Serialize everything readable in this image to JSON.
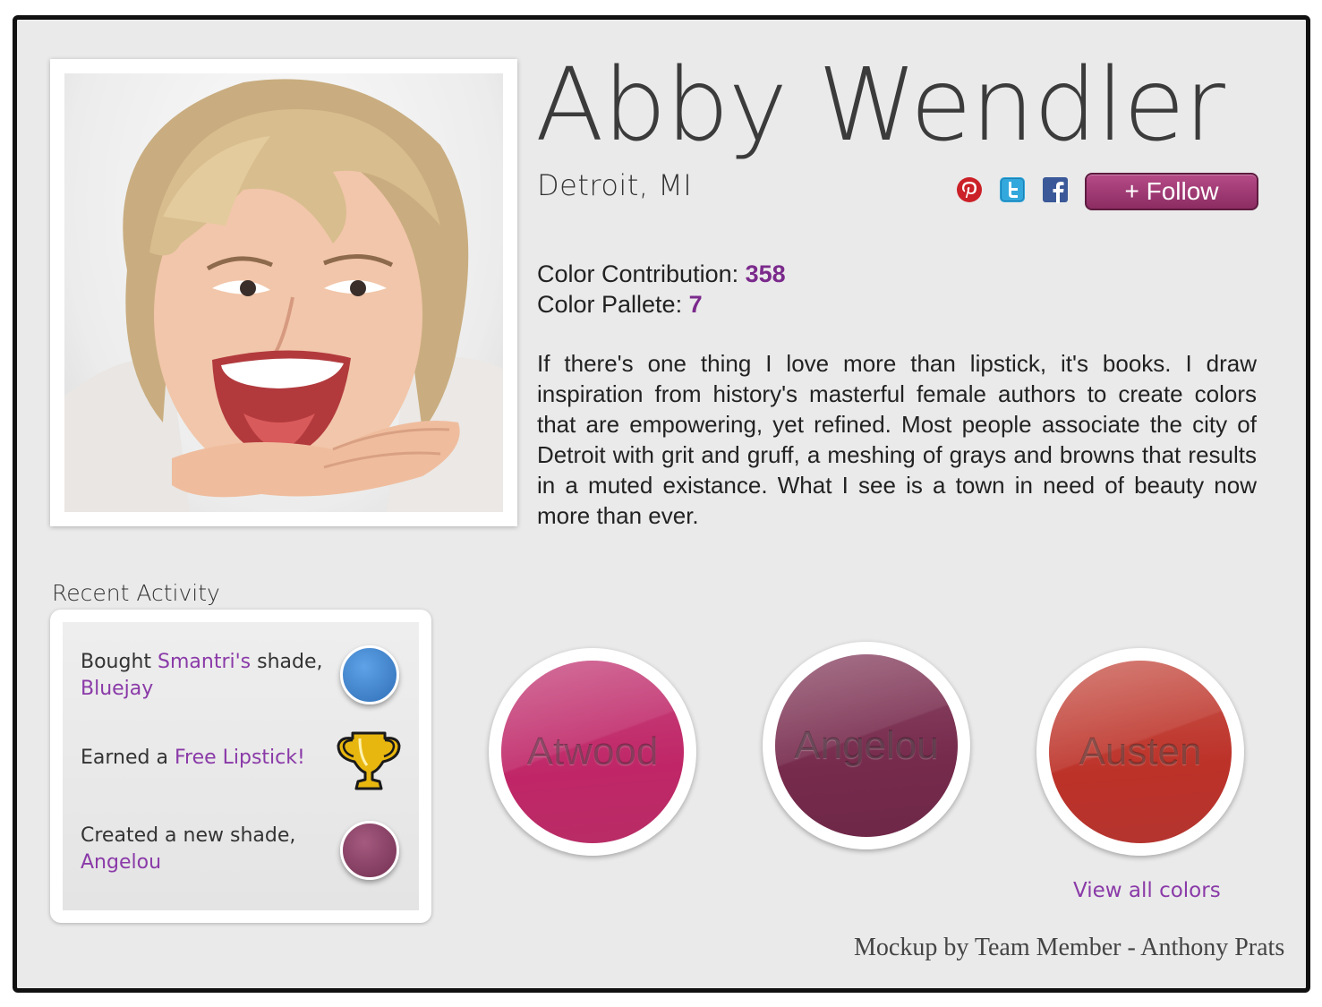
{
  "profile": {
    "name": "Abby Wendler",
    "location": "Detroit, MI",
    "follow_label": "+ Follow",
    "stats": {
      "contribution_label": "Color Contribution:",
      "contribution_value": "358",
      "pallete_label": "Color Pallete:",
      "pallete_value": "7"
    },
    "bio": "If there's one thing I love more than lipstick, it's books. I draw inspiration from history's masterful female authors to create colors that are empowering, yet refined. Most people associate the city of Detroit with grit and gruff, a meshing of grays and browns that results in a muted existance. What I see is a town in need of beauty now more than ever."
  },
  "social": {
    "icons": [
      "pinterest-icon",
      "twitter-icon",
      "facebook-icon"
    ],
    "colors": {
      "pinterest": "#cb2027",
      "twitter": "#33a8dc",
      "facebook": "#3b5998"
    }
  },
  "activity": {
    "title": "Recent Activity",
    "items": [
      {
        "prefix": "Bought ",
        "link1": "Smantri's",
        "middle": " shade,",
        "link2": "Bluejay",
        "icon": "blue-swatch-icon",
        "color": "#3d82d0"
      },
      {
        "prefix": "Earned a ",
        "link1": "Free Lipstick!",
        "icon": "trophy-icon",
        "color": "#e8b70f"
      },
      {
        "prefix": "Created a new shade,",
        "link2": "Angelou",
        "icon": "angelou-swatch-icon",
        "color": "#8a3a62"
      }
    ]
  },
  "swatches": [
    {
      "label": "Atwood",
      "color": "#c62b6d"
    },
    {
      "label": "Angelou",
      "color": "#7c2b4e"
    },
    {
      "label": "Austen",
      "color": "#c0332d"
    }
  ],
  "view_all": "View all colors",
  "credit": "Mockup by Team Member - Anthony Prats",
  "accent": "#8a3aa8"
}
